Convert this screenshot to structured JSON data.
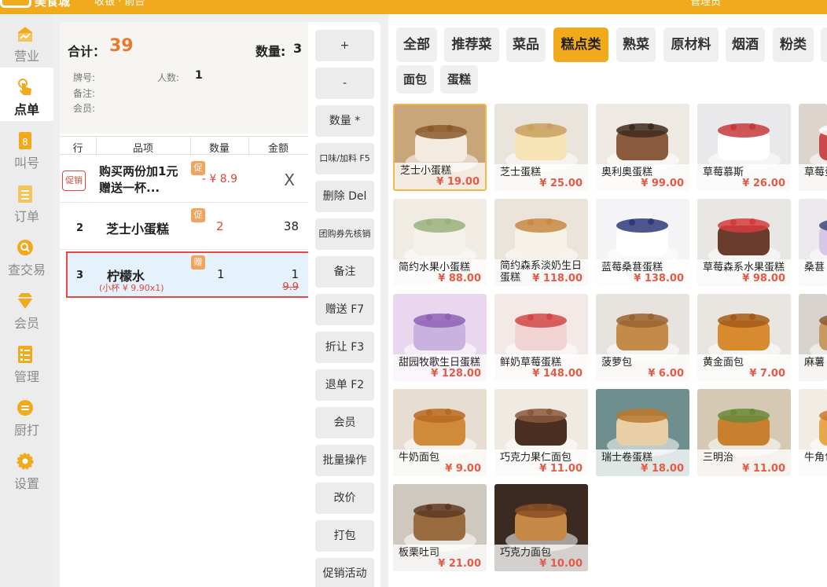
{
  "topbar": {
    "brand": "美食城",
    "store": "收银 · 前台",
    "user": "管理员"
  },
  "nav": [
    {
      "label": "营业",
      "icon": "shop-icon"
    },
    {
      "label": "点单",
      "icon": "tap-hand-icon",
      "active": true
    },
    {
      "label": "叫号",
      "icon": "number-icon"
    },
    {
      "label": "订单",
      "icon": "list-icon"
    },
    {
      "label": "查交易",
      "icon": "search-icon"
    },
    {
      "label": "会员",
      "icon": "diamond-icon"
    },
    {
      "label": "管理",
      "icon": "checklist-icon"
    },
    {
      "label": "厨打",
      "icon": "printer-icon"
    },
    {
      "label": "设置",
      "icon": "gear-icon"
    }
  ],
  "summary": {
    "total_label": "合计：",
    "total": "39",
    "qty_label": "数量:",
    "qty": "3",
    "table_label": "牌号:",
    "people_label": "人数:",
    "people": "1",
    "note_label": "备注:",
    "member_label": "会员:"
  },
  "table_headers": [
    "行",
    "品项",
    "数量",
    "金额"
  ],
  "order_rows": [
    {
      "tag": "促销",
      "name_line1": "购买两份加1元",
      "name_line2": "赠送一杯...",
      "badge": "促",
      "qty": "",
      "amount": "- ¥ 8.9",
      "remove": "X"
    },
    {
      "num": "2",
      "name": "芝士小蛋糕",
      "badge": "促",
      "qty": "2",
      "amount": "38"
    },
    {
      "num": "3",
      "name": "柠檬水",
      "sub": "(小杯 ¥ 9.90x1)",
      "badge": "赠",
      "qty": "1",
      "amount": "1",
      "orig": "9.9"
    }
  ],
  "actions": [
    "+",
    "-",
    "数量 *",
    "口味/加料 F5",
    "删除 Del",
    "团购券先核销",
    "备注",
    "赠送 F7",
    "折让 F3",
    "退单 F2",
    "会员",
    "批量操作",
    "改价",
    "打包",
    "促销活动"
  ],
  "categories": [
    "全部",
    "推荐菜",
    "菜品",
    "糕点类",
    "熟菜",
    "原材料",
    "烟酒",
    "粉类",
    "面包",
    "蛋糕"
  ],
  "active_category": "糕点类",
  "products": [
    {
      "name": "芝士小蛋糕",
      "price": "¥ 19.00"
    },
    {
      "name": "芝士蛋糕",
      "price": "¥ 25.00"
    },
    {
      "name": "奥利奥蛋糕",
      "price": "¥ 99.00"
    },
    {
      "name": "草莓慕斯",
      "price": "¥ 26.00"
    },
    {
      "name": "草莓蛋糕",
      "price": ""
    },
    {
      "name": "简约水果小蛋糕",
      "price": "¥ 88.00"
    },
    {
      "name": "简约森系淡奶生日蛋糕",
      "price": "¥ 118.00"
    },
    {
      "name": "蓝莓桑葚蛋糕",
      "price": "¥ 138.00"
    },
    {
      "name": "草莓森系水果蛋糕",
      "price": "¥ 98.00"
    },
    {
      "name": "桑葚",
      "price": ""
    },
    {
      "name": "甜园牧歌生日蛋糕",
      "price": "¥ 128.00"
    },
    {
      "name": "鲜奶草莓蛋糕",
      "price": "¥ 148.00"
    },
    {
      "name": "菠萝包",
      "price": "¥ 6.00"
    },
    {
      "name": "黄金面包",
      "price": "¥ 7.00"
    },
    {
      "name": "麻薯",
      "price": ""
    },
    {
      "name": "牛奶面包",
      "price": "¥ 9.00"
    },
    {
      "name": "巧克力果仁面包",
      "price": "¥ 11.00"
    },
    {
      "name": "瑞士卷蛋糕",
      "price": "¥ 18.00"
    },
    {
      "name": "三明治",
      "price": "¥ 11.00"
    },
    {
      "name": "牛角包",
      "price": ""
    },
    {
      "name": "板栗吐司",
      "price": "¥ 21.00"
    },
    {
      "name": "巧克力面包",
      "price": "¥ 10.00"
    }
  ]
}
